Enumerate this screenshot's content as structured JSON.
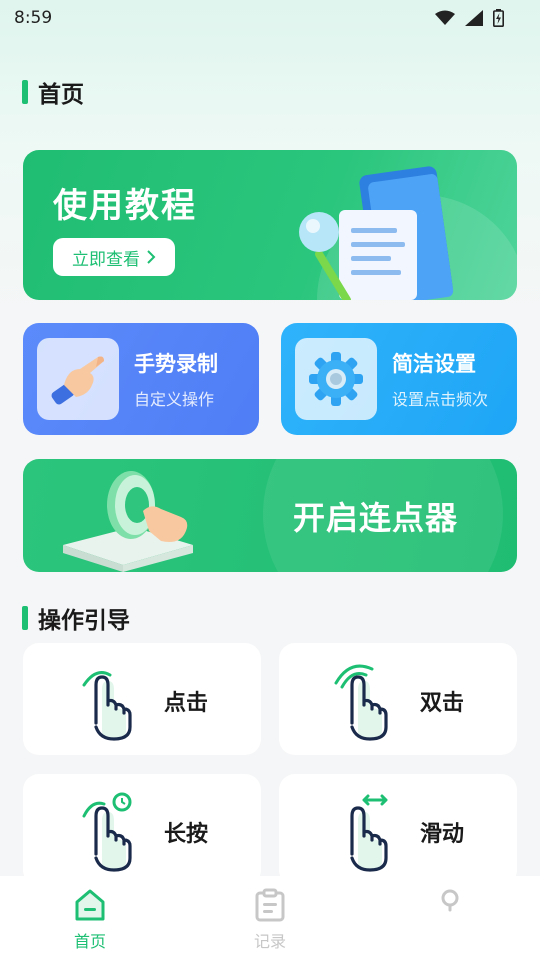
{
  "status_bar": {
    "time": "8:59"
  },
  "header": {
    "title": "首页"
  },
  "banner": {
    "title": "使用教程",
    "button_label": "立即查看"
  },
  "feature_cards": [
    {
      "title": "手势录制",
      "subtitle": "自定义操作",
      "icon": "pointing-hand-icon"
    },
    {
      "title": "简洁设置",
      "subtitle": "设置点击频次",
      "icon": "gear-icon"
    }
  ],
  "start_card": {
    "label": "开启连点器"
  },
  "guide": {
    "title": "操作引导",
    "items": [
      {
        "label": "点击",
        "icon": "tap-gesture-icon"
      },
      {
        "label": "双击",
        "icon": "double-tap-gesture-icon"
      },
      {
        "label": "长按",
        "icon": "long-press-gesture-icon"
      },
      {
        "label": "滑动",
        "icon": "swipe-gesture-icon"
      }
    ]
  },
  "tabbar": {
    "items": [
      {
        "label": "首页",
        "icon": "home-icon",
        "active": true
      },
      {
        "label": "记录",
        "icon": "clipboard-icon",
        "active": false
      },
      {
        "label": "",
        "icon": "profile-icon",
        "active": false
      }
    ]
  },
  "colors": {
    "primary_green": "#1dbf73",
    "gesture_blue": "#4f7df5",
    "settings_blue": "#1ea5f5"
  }
}
